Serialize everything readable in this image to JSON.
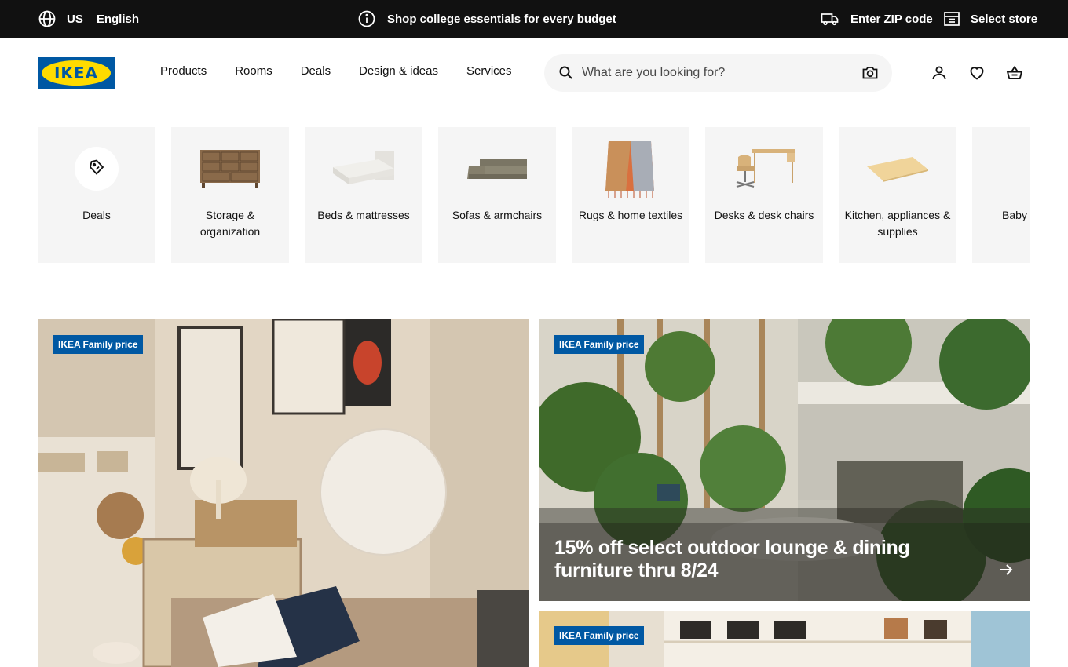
{
  "topbar": {
    "country": "US",
    "language": "English",
    "promo": "Shop college essentials for every budget",
    "zip": "Enter ZIP code",
    "store": "Select store"
  },
  "header": {
    "logo_text": "IKEA",
    "nav": [
      "Products",
      "Rooms",
      "Deals",
      "Design & ideas",
      "Services"
    ],
    "search_placeholder": "What are you looking for?",
    "icons": [
      "account-icon",
      "heart-icon",
      "cart-icon"
    ]
  },
  "categories": [
    {
      "label": "Deals",
      "icon": "deals-tag-icon"
    },
    {
      "label": "Storage & organization",
      "icon": "dresser-image"
    },
    {
      "label": "Beds & mattresses",
      "icon": "bed-image"
    },
    {
      "label": "Sofas & armchairs",
      "icon": "sofa-image"
    },
    {
      "label": "Rugs & home textiles",
      "icon": "throw-blanket-image"
    },
    {
      "label": "Desks & desk chairs",
      "icon": "desk-image"
    },
    {
      "label": "Kitchen, appliances & supplies",
      "icon": "countertop-image"
    },
    {
      "label": "Baby & kids",
      "icon": "kids-storage-image"
    }
  ],
  "hero": {
    "left": {
      "badge": "IKEA Family price"
    },
    "right": {
      "badge": "IKEA Family price",
      "headline": "15% off select outdoor lounge & dining furniture thru 8/24"
    },
    "right2": {
      "badge": "IKEA Family price"
    }
  },
  "colors": {
    "topbar_bg": "#111111",
    "brand_blue": "#0058a3",
    "brand_yellow": "#ffdb00",
    "card_bg": "#f5f5f5"
  }
}
